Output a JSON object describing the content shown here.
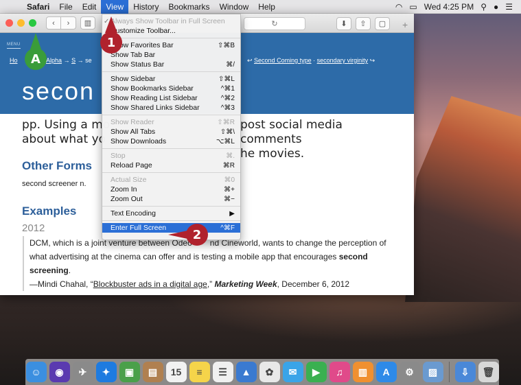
{
  "menubar": {
    "app_name": "Safari",
    "items": [
      "File",
      "Edit",
      "View",
      "History",
      "Bookmarks",
      "Window",
      "Help"
    ],
    "active_item": "View",
    "clock": "Wed 4:25 PM"
  },
  "browser": {
    "address_icon": "reload-icon"
  },
  "page": {
    "menu_label": "MENU",
    "breadcrumb": {
      "home": "Ho",
      "alpha": "Alpha",
      "s": "S",
      "rest": "se"
    },
    "nextprev": {
      "prev": "Second Coming type",
      "sep": " · ",
      "next": "secondary virginity"
    },
    "big_title": "secon",
    "lead_a": "pp. Using a mo",
    "lead_a2": "about what yo",
    "lead_right_1": "post social media comments",
    "lead_right_2": "he movies.",
    "other_forms": "Other Forms",
    "screener": "second screener n.",
    "examples": "Examples",
    "year": "2012",
    "quote": {
      "part1": "DCM, which is a joint venture between Odeo",
      "part1b": "nd Cineworld, wants to change the perception of",
      "line2": "what advertising at the cinema can offer and is testing a mobile app that encourages ",
      "bold": "second screening",
      "end": ".",
      "cite_prefix": "—Mindi Chahal, “",
      "cite_link": "Blockbuster ads in a digital age",
      "cite_mid": ",” ",
      "cite_pub": "Marketing Week",
      "cite_date": ", December 6, 2012"
    }
  },
  "view_menu": {
    "items": [
      {
        "label": "Always Show Toolbar in Full Screen",
        "shortcut": "",
        "disabled": true,
        "checked": true
      },
      {
        "label": "Customize Toolbar...",
        "shortcut": ""
      },
      {
        "sep": true
      },
      {
        "label": "Show Favorites Bar",
        "shortcut": "⇧⌘B"
      },
      {
        "label": "Show Tab Bar",
        "shortcut": ""
      },
      {
        "label": "Show Status Bar",
        "shortcut": "⌘/"
      },
      {
        "sep": true
      },
      {
        "label": "Show Sidebar",
        "shortcut": "⇧⌘L"
      },
      {
        "label": "Show Bookmarks Sidebar",
        "shortcut": "^⌘1"
      },
      {
        "label": "Show Reading List Sidebar",
        "shortcut": "^⌘2"
      },
      {
        "label": "Show Shared Links Sidebar",
        "shortcut": "^⌘3"
      },
      {
        "sep": true
      },
      {
        "label": "Show Reader",
        "shortcut": "⇧⌘R",
        "disabled": true
      },
      {
        "label": "Show All Tabs",
        "shortcut": "⇧⌘\\"
      },
      {
        "label": "Show Downloads",
        "shortcut": "⌥⌘L"
      },
      {
        "sep": true
      },
      {
        "label": "Stop",
        "shortcut": "⌘.",
        "disabled": true
      },
      {
        "label": "Reload Page",
        "shortcut": "⌘R"
      },
      {
        "sep": true
      },
      {
        "label": "Actual Size",
        "shortcut": "⌘0",
        "disabled": true
      },
      {
        "label": "Zoom In",
        "shortcut": "⌘+"
      },
      {
        "label": "Zoom Out",
        "shortcut": "⌘−"
      },
      {
        "sep": true
      },
      {
        "label": "Text Encoding",
        "shortcut": "▶"
      },
      {
        "sep": true
      },
      {
        "label": "Enter Full Screen",
        "shortcut": "^⌘F",
        "highlight": true
      }
    ]
  },
  "callouts": {
    "one": "1",
    "two": "2",
    "a": "A"
  },
  "dock": {
    "icons": [
      {
        "name": "finder-icon",
        "color": "#3b8fe0",
        "glyph": "☺"
      },
      {
        "name": "siri-icon",
        "color": "#5a3ab0",
        "glyph": "◉"
      },
      {
        "name": "launchpad-icon",
        "color": "#8a8a8a",
        "glyph": "✈"
      },
      {
        "name": "safari-icon",
        "color": "#1e7be0",
        "glyph": "✦"
      },
      {
        "name": "photos-browser-icon",
        "color": "#4aa04a",
        "glyph": "▣"
      },
      {
        "name": "contacts-icon",
        "color": "#b08050",
        "glyph": "▤"
      },
      {
        "name": "calendar-icon",
        "color": "#f2f2f2",
        "glyph": "15"
      },
      {
        "name": "notes-icon",
        "color": "#f5d44a",
        "glyph": "≡"
      },
      {
        "name": "reminders-icon",
        "color": "#f0f0f0",
        "glyph": "☰"
      },
      {
        "name": "keynote-icon",
        "color": "#3a7ad0",
        "glyph": "▲"
      },
      {
        "name": "photos-icon",
        "color": "#e8e8e8",
        "glyph": "✿"
      },
      {
        "name": "messages-icon",
        "color": "#3aa4e8",
        "glyph": "✉"
      },
      {
        "name": "facetime-icon",
        "color": "#3ab050",
        "glyph": "▶"
      },
      {
        "name": "itunes-icon",
        "color": "#e04a8a",
        "glyph": "♫"
      },
      {
        "name": "ibooks-icon",
        "color": "#f09030",
        "glyph": "▥"
      },
      {
        "name": "app-store-icon",
        "color": "#2e8ae8",
        "glyph": "A"
      },
      {
        "name": "system-preferences-icon",
        "color": "#8a8a8a",
        "glyph": "⚙"
      },
      {
        "name": "preview-icon",
        "color": "#6a9ad0",
        "glyph": "▨"
      },
      {
        "name": "downloads-stack-icon",
        "color": "#4a88d8",
        "glyph": "⇩"
      },
      {
        "name": "trash-icon",
        "color": "#d8d8d8",
        "glyph": "🗑"
      }
    ]
  }
}
